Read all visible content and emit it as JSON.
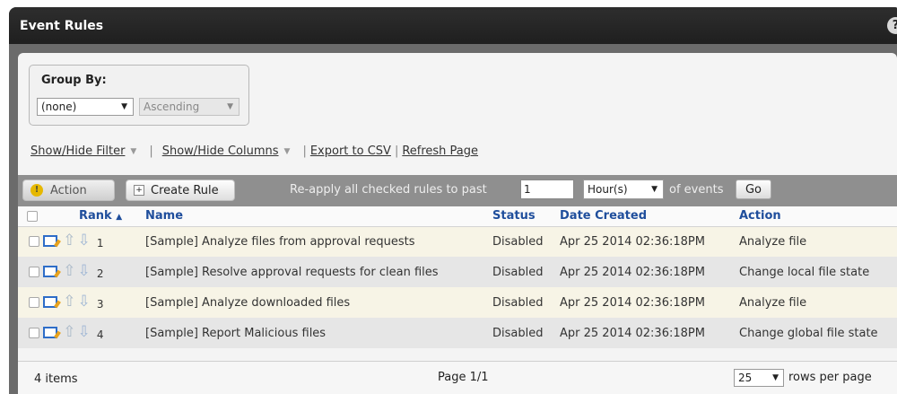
{
  "window": {
    "title": "Event Rules",
    "help_icon": "question-mark-icon",
    "help_label": "?"
  },
  "group_by": {
    "label": "Group By:",
    "field_value": "(none)",
    "order_value": "Ascending"
  },
  "links": {
    "show_hide_filter": "Show/Hide Filter",
    "show_hide_columns": "Show/Hide Columns",
    "export_csv": "Export to CSV",
    "refresh_page": "Refresh Page"
  },
  "toolbar": {
    "action_label": "Action",
    "create_rule_label": "Create Rule",
    "reapply_text": "Re-apply all checked rules to past",
    "reapply_value": "1",
    "unit_value": "Hour(s)",
    "of_events_text": "of events",
    "go_label": "Go"
  },
  "table": {
    "columns": {
      "rank": "Rank",
      "rank_sort": "▲",
      "name": "Name",
      "status": "Status",
      "date_created": "Date Created",
      "action": "Action"
    },
    "rows": [
      {
        "rank": "1",
        "name": "[Sample] Analyze files from approval requests",
        "status": "Disabled",
        "date_created": "Apr 25 2014 02:36:18PM",
        "action": "Analyze file"
      },
      {
        "rank": "2",
        "name": "[Sample] Resolve approval requests for clean files",
        "status": "Disabled",
        "date_created": "Apr 25 2014 02:36:18PM",
        "action": "Change local file state"
      },
      {
        "rank": "3",
        "name": "[Sample] Analyze downloaded files",
        "status": "Disabled",
        "date_created": "Apr 25 2014 02:36:18PM",
        "action": "Analyze file"
      },
      {
        "rank": "4",
        "name": "[Sample] Report Malicious files",
        "status": "Disabled",
        "date_created": "Apr 25 2014 02:36:18PM",
        "action": "Change global file state"
      }
    ]
  },
  "footer": {
    "items_count": "4 items",
    "page_info": "Page 1/1",
    "rows_value": "25",
    "rows_label": "rows per page"
  },
  "colors": {
    "title_bar": "#1f1f1f",
    "header_link": "#1f4e9c",
    "row_odd": "#f7f4e6",
    "row_even": "#e6e6e6"
  }
}
